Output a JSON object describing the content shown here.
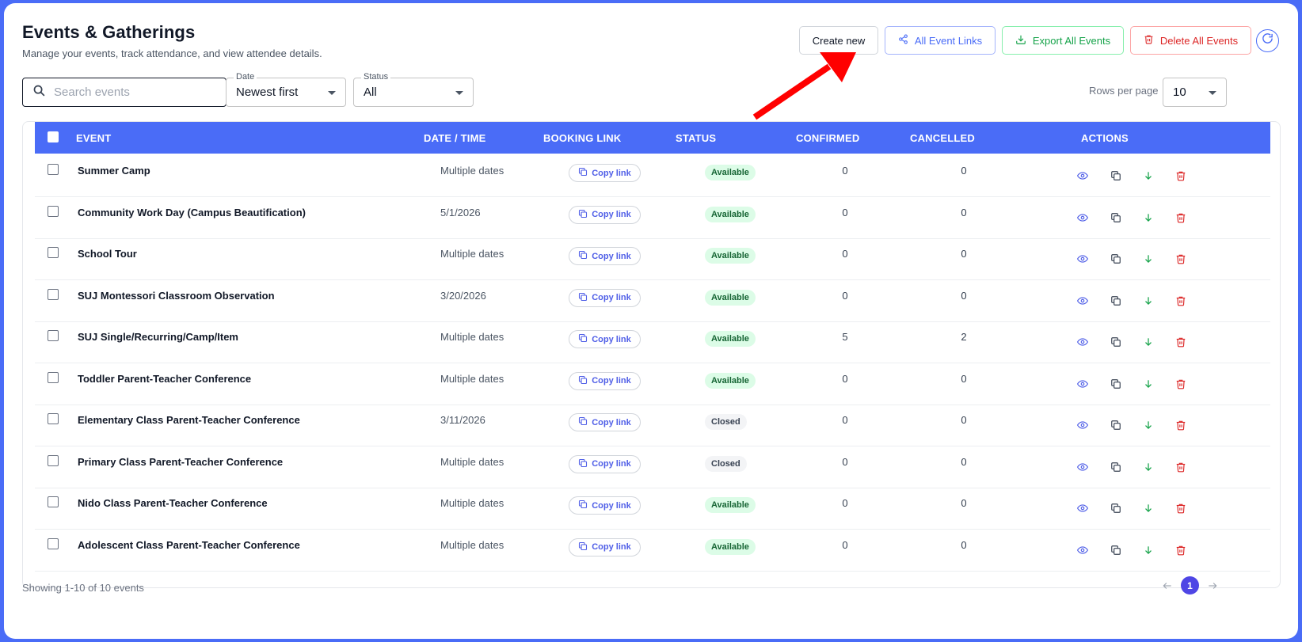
{
  "header": {
    "title": "Events & Gatherings",
    "subtitle": "Manage your events, track attendance, and view attendee details."
  },
  "toolbar": {
    "create_label": "Create new",
    "links_label": "All Event Links",
    "export_label": "Export All Events",
    "delete_label": "Delete All Events",
    "refresh_icon": "refresh-icon"
  },
  "filters": {
    "search_placeholder": "Search events",
    "search_value": "",
    "date_legend": "Date",
    "date_value": "Newest first",
    "status_legend": "Status",
    "status_value": "All",
    "rows_per_page_label": "Rows per page",
    "rows_per_page_value": "10"
  },
  "table": {
    "columns": [
      "EVENT",
      "DATE / TIME",
      "BOOKING LINK",
      "STATUS",
      "CONFIRMED",
      "CANCELLED",
      "ACTIONS"
    ],
    "copy_link_label": "Copy link",
    "rows": [
      {
        "name": "Summer Camp",
        "date": "Multiple dates",
        "status": "Available",
        "confirmed": "0",
        "cancelled": "0"
      },
      {
        "name": "Community Work Day (Campus Beautification)",
        "date": "5/1/2026",
        "status": "Available",
        "confirmed": "0",
        "cancelled": "0"
      },
      {
        "name": "School Tour",
        "date": "Multiple dates",
        "status": "Available",
        "confirmed": "0",
        "cancelled": "0"
      },
      {
        "name": "SUJ Montessori Classroom Observation",
        "date": "3/20/2026",
        "status": "Available",
        "confirmed": "0",
        "cancelled": "0"
      },
      {
        "name": "SUJ Single/Recurring/Camp/Item",
        "date": "Multiple dates",
        "status": "Available",
        "confirmed": "5",
        "cancelled": "2"
      },
      {
        "name": "Toddler Parent-Teacher Conference",
        "date": "Multiple dates",
        "status": "Available",
        "confirmed": "0",
        "cancelled": "0"
      },
      {
        "name": "Elementary Class Parent-Teacher Conference",
        "date": "3/11/2026",
        "status": "Closed",
        "confirmed": "0",
        "cancelled": "0"
      },
      {
        "name": "Primary Class Parent-Teacher Conference",
        "date": "Multiple dates",
        "status": "Closed",
        "confirmed": "0",
        "cancelled": "0"
      },
      {
        "name": "Nido Class Parent-Teacher Conference",
        "date": "Multiple dates",
        "status": "Available",
        "confirmed": "0",
        "cancelled": "0"
      },
      {
        "name": "Adolescent Class Parent-Teacher Conference",
        "date": "Multiple dates",
        "status": "Available",
        "confirmed": "0",
        "cancelled": "0"
      }
    ]
  },
  "footer": {
    "showing_text": "Showing 1-10 of 10 events",
    "current_page": "1"
  },
  "colors": {
    "accent": "#4a6cf7",
    "available_bg": "#dcfce7",
    "closed_bg": "#f3f4f6",
    "delete": "#dc2626",
    "export": "#16a34a",
    "annotation_arrow": "#ff0000"
  }
}
